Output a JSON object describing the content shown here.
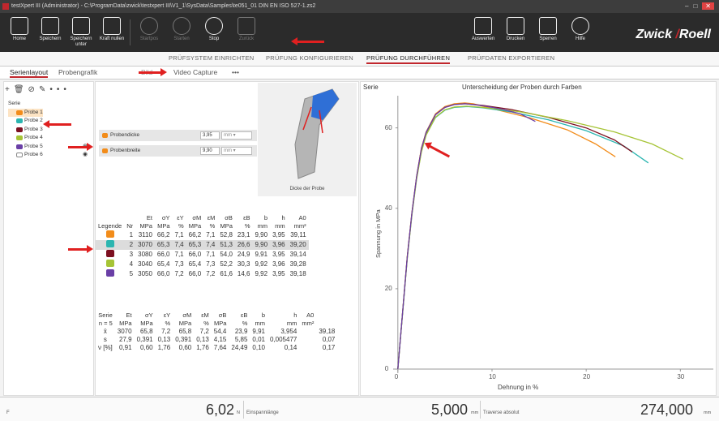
{
  "window": {
    "title": "testXpert III (Administrator) - C:\\ProgramData\\zwick\\testxpert III\\V1_1\\SysData\\Samples\\te051_01 DIN EN ISO 527-1.zs2"
  },
  "toolbar": {
    "left": [
      {
        "label": "Home"
      },
      {
        "label": "Speichern"
      },
      {
        "label": "Speichern unter"
      },
      {
        "label": "Kraft nullen"
      },
      {
        "label": "Startpos"
      },
      {
        "label": "Starten"
      },
      {
        "label": "Stop"
      },
      {
        "label": "Zurück"
      }
    ],
    "right": [
      {
        "label": "Auswerten"
      },
      {
        "label": "Drucken"
      },
      {
        "label": "Sperren"
      },
      {
        "label": "Hilfe"
      }
    ],
    "brand_a": "Zwick",
    "brand_b": "Roell"
  },
  "tabs": [
    {
      "label": "PRÜFSYSTEM EINRICHTEN"
    },
    {
      "label": "PRÜFUNG KONFIGURIEREN"
    },
    {
      "label": "PRÜFUNG DURCHFÜHREN"
    },
    {
      "label": "PRÜFDATEN EXPORTIEREN"
    }
  ],
  "subtabs": [
    {
      "label": "Serienlayout"
    },
    {
      "label": "Probengrafik"
    },
    {
      "label": "Bild"
    },
    {
      "label": "Video Capture"
    },
    {
      "label": "•••"
    }
  ],
  "tree": {
    "root": "Serie",
    "items": [
      {
        "label": "Probe 1",
        "color": "#f28c1a"
      },
      {
        "label": "Probe 2",
        "color": "#2bb5b0"
      },
      {
        "label": "Probe 3",
        "color": "#7d1020"
      },
      {
        "label": "Probe 4",
        "color": "#a6c436"
      },
      {
        "label": "Probe 5",
        "color": "#6a3fa6"
      },
      {
        "label": "Probe 6",
        "color": "#ffffff"
      }
    ]
  },
  "params": [
    {
      "label": "Probendicke",
      "value": "3,95",
      "unit": "mm"
    },
    {
      "label": "Probenbreite",
      "value": "9,90",
      "unit": "mm"
    }
  ],
  "specimen_caption": "Dicke der Probe",
  "results": {
    "headers_1": [
      "",
      "",
      "Et",
      "σY",
      "εY",
      "σM",
      "εM",
      "σB",
      "εB",
      "b",
      "h",
      "A0"
    ],
    "headers_2": [
      "Legende",
      "Nr",
      "MPa",
      "MPa",
      "%",
      "MPa",
      "%",
      "MPa",
      "%",
      "mm",
      "mm",
      "mm²"
    ],
    "rows": [
      {
        "nr": "1",
        "color": "#f28c1a",
        "cells": [
          "3110",
          "66,2",
          "7,1",
          "66,2",
          "7,1",
          "52,8",
          "23,1",
          "9,90",
          "3,95",
          "39,11"
        ]
      },
      {
        "nr": "2",
        "color": "#2bb5b0",
        "cells": [
          "3070",
          "65,3",
          "7,4",
          "65,3",
          "7,4",
          "51,3",
          "26,6",
          "9,90",
          "3,96",
          "39,20"
        ]
      },
      {
        "nr": "3",
        "color": "#7d1020",
        "cells": [
          "3080",
          "66,0",
          "7,1",
          "66,0",
          "7,1",
          "54,0",
          "24,9",
          "9,91",
          "3,95",
          "39,14"
        ]
      },
      {
        "nr": "4",
        "color": "#a6c436",
        "cells": [
          "3040",
          "65,4",
          "7,3",
          "65,4",
          "7,3",
          "52,2",
          "30,3",
          "9,92",
          "3,96",
          "39,28"
        ]
      },
      {
        "nr": "5",
        "color": "#6a3fa6",
        "cells": [
          "3050",
          "66,0",
          "7,2",
          "66,0",
          "7,2",
          "61,6",
          "14,6",
          "9,92",
          "3,95",
          "39,18"
        ]
      }
    ]
  },
  "stats": {
    "headers_1": [
      "Serie",
      "Et",
      "σY",
      "εY",
      "σM",
      "εM",
      "σB",
      "εB",
      "b",
      "h",
      "A0"
    ],
    "headers_2": [
      "n = 5",
      "MPa",
      "MPa",
      "%",
      "MPa",
      "%",
      "MPa",
      "%",
      "mm",
      "mm",
      "mm²"
    ],
    "rows": [
      {
        "label": "x̄",
        "cells": [
          "3070",
          "65,8",
          "7,2",
          "65,8",
          "7,2",
          "54,4",
          "23,9",
          "9,91",
          "3,954",
          "",
          "39,18"
        ]
      },
      {
        "label": "s",
        "cells": [
          "27,9",
          "0,391",
          "0,13",
          "0,391",
          "0,13",
          "4,15",
          "5,85",
          "0,01",
          "0,005477",
          "",
          "0,07"
        ]
      },
      {
        "label": "ν [%]",
        "cells": [
          "0,91",
          "0,60",
          "1,76",
          "0,60",
          "1,76",
          "7,64",
          "24,49",
          "0,10",
          "0,14",
          "",
          "0,17"
        ]
      }
    ]
  },
  "chart_data": {
    "type": "line",
    "tag": "Serie",
    "title": "Unterscheidung der Proben durch Farben",
    "xlabel": "Dehnung in %",
    "ylabel": "Spannung in MPa",
    "xlim": [
      -0.5,
      33.5
    ],
    "ylim": [
      -1,
      68
    ],
    "xticks": [
      0,
      10,
      20,
      30
    ],
    "yticks": [
      0,
      20,
      40,
      60
    ],
    "series": [
      {
        "color": "#f28c1a",
        "x": [
          0,
          0.5,
          1,
          1.5,
          2,
          2.5,
          3,
          4,
          5,
          6,
          7.1,
          8,
          10,
          14,
          18,
          21,
          23.1
        ],
        "y": [
          0,
          14,
          28,
          39,
          48,
          55,
          59,
          63.5,
          65.3,
          66.0,
          66.2,
          66.0,
          64.8,
          62.5,
          59.5,
          56,
          52.8
        ]
      },
      {
        "color": "#2bb5b0",
        "x": [
          0,
          0.5,
          1,
          1.5,
          2,
          2.5,
          3,
          4,
          5,
          6,
          7.4,
          9,
          12,
          16,
          20,
          24,
          26.6
        ],
        "y": [
          0,
          13.8,
          27.6,
          38.5,
          47.5,
          54.2,
          58.3,
          62.6,
          64.4,
          65.1,
          65.3,
          65.0,
          64.0,
          62.0,
          59.3,
          55.5,
          51.3
        ]
      },
      {
        "color": "#7d1020",
        "x": [
          0,
          0.5,
          1,
          1.5,
          2,
          2.5,
          3,
          4,
          5,
          6,
          7.1,
          9,
          12,
          16,
          20,
          23,
          24.9
        ],
        "y": [
          0,
          13.9,
          27.8,
          38.8,
          47.8,
          54.8,
          58.8,
          63.3,
          65.1,
          65.8,
          66.0,
          65.6,
          64.6,
          62.6,
          60.0,
          57.0,
          54.0
        ]
      },
      {
        "color": "#a6c436",
        "x": [
          0,
          0.5,
          1,
          1.5,
          2,
          2.5,
          3,
          4,
          5,
          6,
          7.3,
          9,
          13,
          18,
          23,
          27,
          30.3
        ],
        "y": [
          0,
          13.7,
          27.4,
          38.4,
          47.3,
          54.0,
          58.2,
          62.7,
          64.5,
          65.2,
          65.4,
          65.1,
          64.0,
          61.8,
          59.0,
          56.0,
          52.2
        ]
      },
      {
        "color": "#6a3fa6",
        "x": [
          0,
          0.5,
          1,
          1.5,
          2,
          2.5,
          3,
          4,
          5,
          6,
          7.2,
          9,
          11,
          13,
          14.6
        ],
        "y": [
          0,
          13.9,
          27.8,
          38.9,
          47.9,
          54.8,
          58.9,
          63.3,
          65.1,
          65.8,
          66.0,
          65.5,
          64.7,
          63.5,
          61.6
        ]
      }
    ]
  },
  "status": {
    "left_marker": "F",
    "v1": "6,02",
    "u1": "N",
    "l1": "Einspannlänge",
    "v2": "5,000",
    "u2": "mm",
    "l2": "Traverse absolut",
    "v3": "274,000",
    "u3": "mm"
  }
}
